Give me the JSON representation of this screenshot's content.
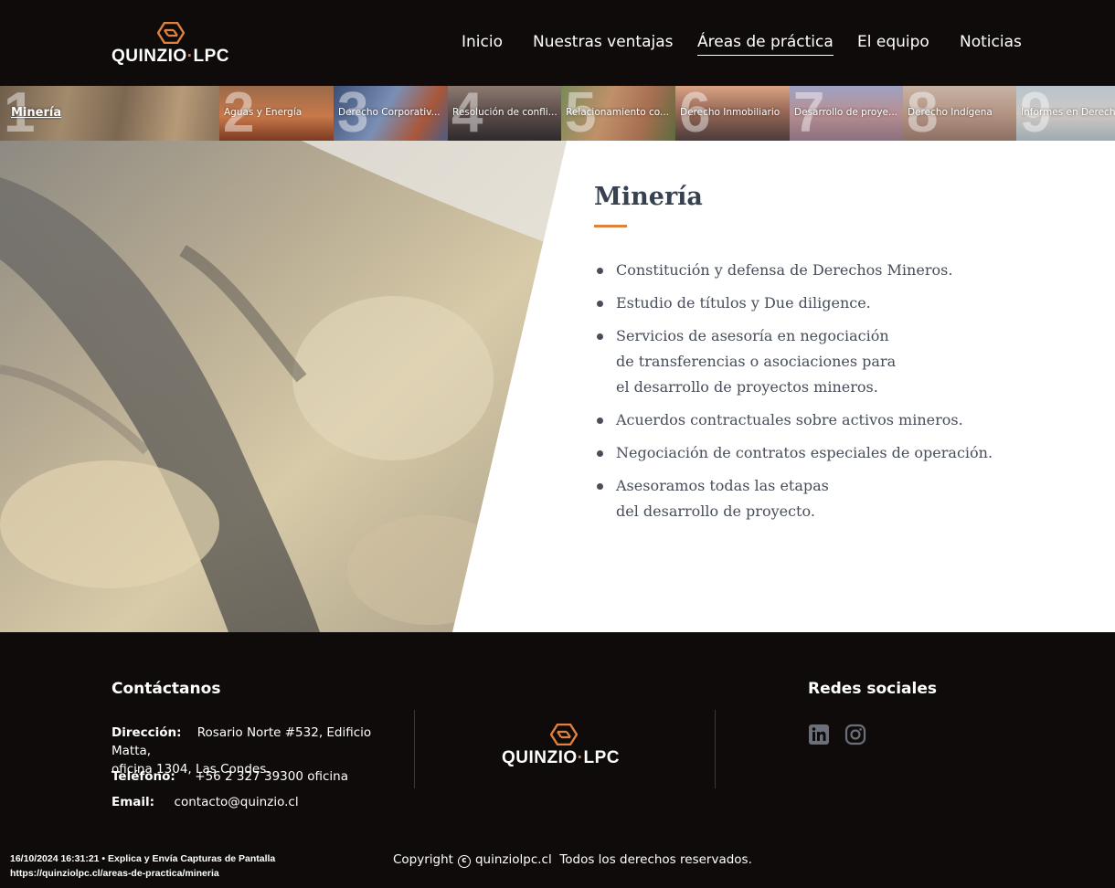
{
  "brand": {
    "logo_text": "QUINZIO",
    "logo_sep": "·",
    "logo_text2": "LPC",
    "accent_color": "#e0813e",
    "dark_color": "#0f0b0b",
    "logo_icon": "hexagon-logo-icon"
  },
  "nav": {
    "items": [
      {
        "label": "Inicio",
        "active": false
      },
      {
        "label": "Nuestras ventajas",
        "active": false
      },
      {
        "label": "Áreas de práctica",
        "active": true
      },
      {
        "label": "El equipo",
        "active": false
      },
      {
        "label": "Noticias",
        "active": false
      }
    ]
  },
  "areas": {
    "tabs": [
      {
        "number": "1",
        "label": "Minería",
        "active": true
      },
      {
        "number": "2",
        "label": "Aguas y Energía"
      },
      {
        "number": "3",
        "label": "Derecho Corporativ..."
      },
      {
        "number": "4",
        "label": "Resolución de confli..."
      },
      {
        "number": "5",
        "label": "Relacionamiento co..."
      },
      {
        "number": "6",
        "label": "Derecho Inmobiliario"
      },
      {
        "number": "7",
        "label": "Desarrollo de proye..."
      },
      {
        "number": "8",
        "label": "Derecho Indígena"
      },
      {
        "number": "9",
        "label": "Informes en Derech"
      }
    ]
  },
  "main": {
    "title": "Minería",
    "items": [
      {
        "lines": [
          "Constitución y defensa de Derechos Mineros."
        ]
      },
      {
        "lines": [
          "Estudio de títulos y Due diligence."
        ]
      },
      {
        "lines": [
          "Servicios de asesoría en negociación",
          "de transferencias o asociaciones para",
          "el desarrollo de proyectos mineros."
        ]
      },
      {
        "lines": [
          "Acuerdos contractuales sobre activos mineros."
        ]
      },
      {
        "lines": [
          "Negociación de contratos especiales de operación."
        ]
      },
      {
        "lines": [
          "Asesoramos todas las etapas",
          "del desarrollo de proyecto."
        ]
      }
    ]
  },
  "footer": {
    "contact_heading": "Contáctanos",
    "address_label": "Dirección:",
    "address_line1": "Rosario Norte #532, Edificio Matta,",
    "address_line2": "oficina 1304, Las Condes.",
    "phone_label": "Teléfono:",
    "phone_value": "+56 2 327 39300 oficina",
    "email_label": "Email:",
    "email_value": "contacto@quinzio.cl",
    "social_heading": "Redes sociales",
    "social_icons": [
      "linkedin-icon",
      "instagram-icon"
    ],
    "copyright_prefix": "Copyright",
    "copyright_site": "quinziolpc.cl",
    "copyright_suffix": "Todos los derechos reservados."
  },
  "capture": {
    "line1": "16/10/2024 16:31:21 • Explica y Envía Capturas de Pantalla",
    "line2": "https://quinziolpc.cl/areas-de-practica/mineria"
  }
}
